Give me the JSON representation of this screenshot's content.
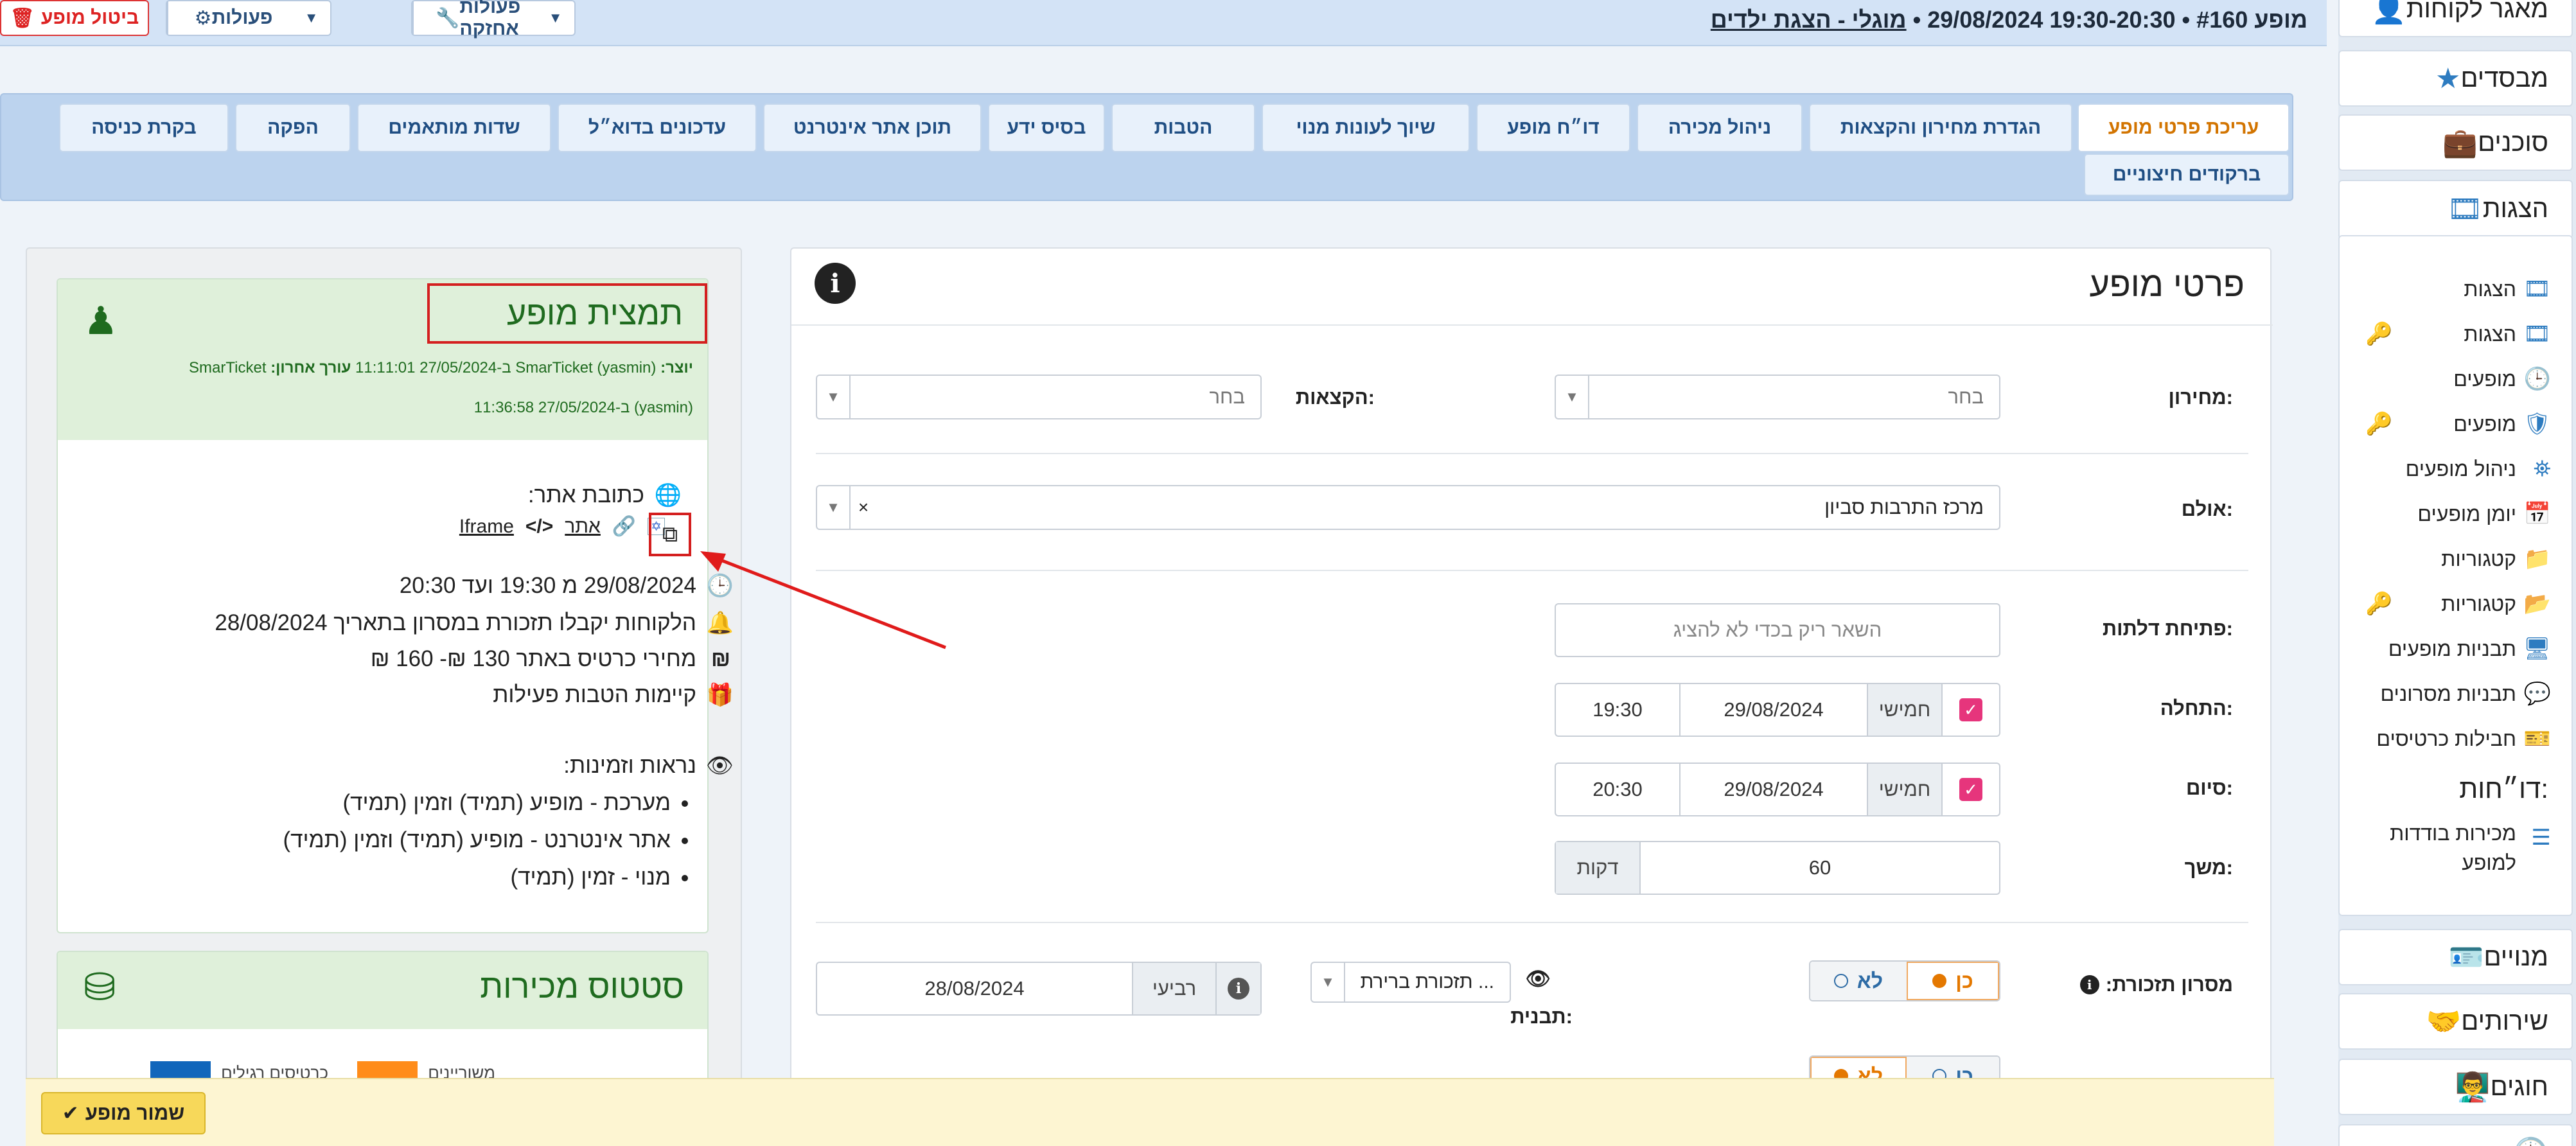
{
  "header": {
    "show_number": "מופע #160",
    "show_datetime": "• 19:30-20:30 29/08/2024 •",
    "show_link": "מוגלי - הצגת ילדים",
    "maintenance_label": "פעולות אחזקה",
    "actions_label": "פעולות",
    "cancel_label": "ביטול מופע"
  },
  "tabs": [
    {
      "label": "עריכת פרטי מופע"
    },
    {
      "label": "הגדרת מחירון והקצאות"
    },
    {
      "label": "ניהול מכירה"
    },
    {
      "label": "דו״ח מופע"
    },
    {
      "label": "שיוך לעונות מנוי"
    },
    {
      "label": "הטבות"
    },
    {
      "label": "בסיס ידע"
    },
    {
      "label": "תוכן אתר אינטרנט"
    },
    {
      "label": "עדכונים בדוא״ל"
    },
    {
      "label": "שדות מותאמים"
    },
    {
      "label": "הפקה"
    },
    {
      "label": "בקרת כניסה"
    },
    {
      "label": "ברקודים חיצוניים"
    }
  ],
  "sidebar": {
    "customers": "מאגר לקוחות",
    "distributors": "מבסדים",
    "agents": "סוכנים",
    "shows": "הצגות",
    "items": [
      {
        "label": "הצגות"
      },
      {
        "label": "הצגות"
      },
      {
        "label": "מופעים"
      },
      {
        "label": "מופעים"
      },
      {
        "label": "ניהול מופעים"
      },
      {
        "label": "יומן מופעים"
      },
      {
        "label": "קטגוריות"
      },
      {
        "label": "קטגוריות"
      },
      {
        "label": "תבניות מופעים"
      },
      {
        "label": "תבניות מסרונים"
      },
      {
        "label": "חבילות כרטיסים"
      }
    ],
    "reports_title": "דו״חות:",
    "report_item": "מכירות בודדות למופע",
    "subscriptions": "מנויים",
    "services": "שירותים",
    "clubs": "חוגים"
  },
  "details": {
    "title": "פרטי מופע",
    "pricelist_label": "מחירון:",
    "pricelist_value": "בחר",
    "allocations_label": "הקצאות:",
    "allocations_value": "בחר",
    "hall_label": "אולם:",
    "hall_value": "מרכז התרבות סביון",
    "doors_label": "פתיחת דלתות:",
    "doors_placeholder": "השאר ריק בכדי לא להציג",
    "start_label": "התחלה:",
    "start_day": "חמישי",
    "start_date": "29/08/2024",
    "start_time": "19:30",
    "end_label": "סיום:",
    "end_day": "חמישי",
    "end_date": "29/08/2024",
    "end_time": "20:30",
    "duration_label": "משך:",
    "duration_value": "60",
    "duration_unit": "דקות",
    "reminder_label": "מסרון תזכורת:",
    "yes": "כן",
    "no": "לא",
    "template_label": "תבנית:",
    "template_value": "תזכורת ברירת ...",
    "reminder_day": "רביעי",
    "reminder_date": "28/08/2024"
  },
  "preview": {
    "title": "תמצית מופע",
    "creator_label": "יוצר:",
    "creator_value": "SmarTicket (yasmin) ב-27/05/2024 11:11:01",
    "editor_label": "עורך אחרון:",
    "editor_value": "SmarTicket",
    "editor_value2": "(yasmin) ב-27/05/2024 11:36:58",
    "site_label": "כתובת אתר:",
    "site_link": "אתר",
    "iframe_link": "Iframe",
    "datetime_line": "29/08/2024 מ 19:30 ועד 20:30",
    "reminder_line": "הלקוחות יקבלו תזכורת במסרון בתאריך 28/08/2024",
    "prices_line": "מחירי כרטיס באתר 130 ₪- 160 ₪",
    "benefits_line": "קיימות הטבות פעילות",
    "visibility_title": "נראות וזמינות:",
    "visibility": [
      "מערכת - מופיע (תמיד) וזמין (תמיד)",
      "אתר אינטרנט - מופיע (תמיד) וזמין (תמיד)",
      "מנוי - זמין (תמיד)"
    ]
  },
  "sales": {
    "title": "סטטוס מכירות",
    "legend_reserved": "משוריינים",
    "legend_regular": "כרטיסים רגילים"
  },
  "footer": {
    "save_label": "שמור מופע"
  },
  "colors": {
    "accent_orange": "#e47800",
    "link_blue": "#1f4e83",
    "highlight_red": "#d41f1f",
    "preview_green": "#1f6b1f",
    "checkbox_pink": "#e6357c",
    "legend_orange": "#ff8c1a",
    "legend_blue": "#1166bb"
  }
}
